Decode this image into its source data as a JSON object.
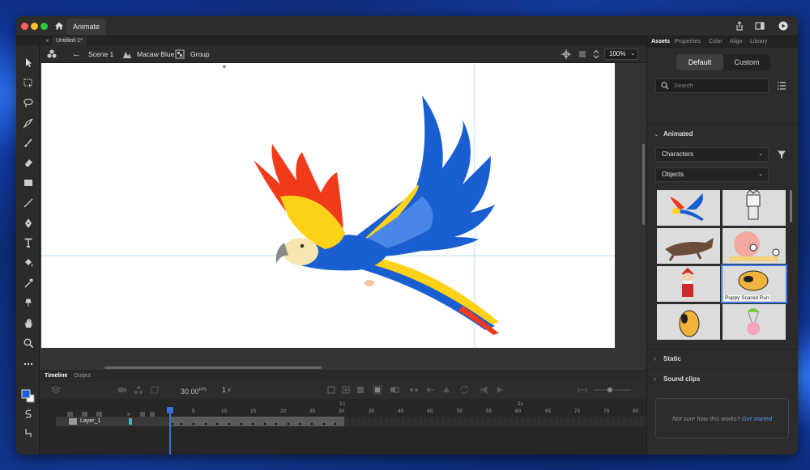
{
  "app": {
    "tab_label": "Animate"
  },
  "document": {
    "tab_label": "Untitled-1*"
  },
  "editbar": {
    "scene": "Scene 1",
    "symbol": "Macaw Blue",
    "group": "Group",
    "zoom": "100%"
  },
  "timeline": {
    "tabs": [
      "Timeline",
      "Output"
    ],
    "fps": "30.00",
    "fps_unit": "FPS",
    "current_frame": "1",
    "ruler": {
      "seconds": [
        "1s",
        "2s"
      ],
      "frames": [
        "5",
        "10",
        "15",
        "20",
        "25",
        "30",
        "35",
        "40",
        "45",
        "50",
        "55",
        "60",
        "65",
        "70",
        "75",
        "80"
      ]
    },
    "layer_name": "Layer_1"
  },
  "panel": {
    "tabs": [
      "Assets",
      "Properties",
      "Color",
      "Align",
      "Library"
    ],
    "segments": [
      "Default",
      "Custom"
    ],
    "search_placeholder": "Search",
    "sections": {
      "animated": "Animated",
      "static": "Static",
      "sound_clips": "Sound clips"
    },
    "dropdown_characters": "Characters",
    "dropdown_objects": "Objects",
    "selected_thumb_caption": "Puppy Scared Run",
    "help_text": "Not sure how this works?",
    "help_link": "Get started"
  },
  "colors": {
    "accent": "#3c7ef0",
    "stage": "#ffffff",
    "macaw_blue": "#1a5fd1",
    "macaw_red": "#f03a1a",
    "macaw_yellow": "#ffd21a"
  }
}
